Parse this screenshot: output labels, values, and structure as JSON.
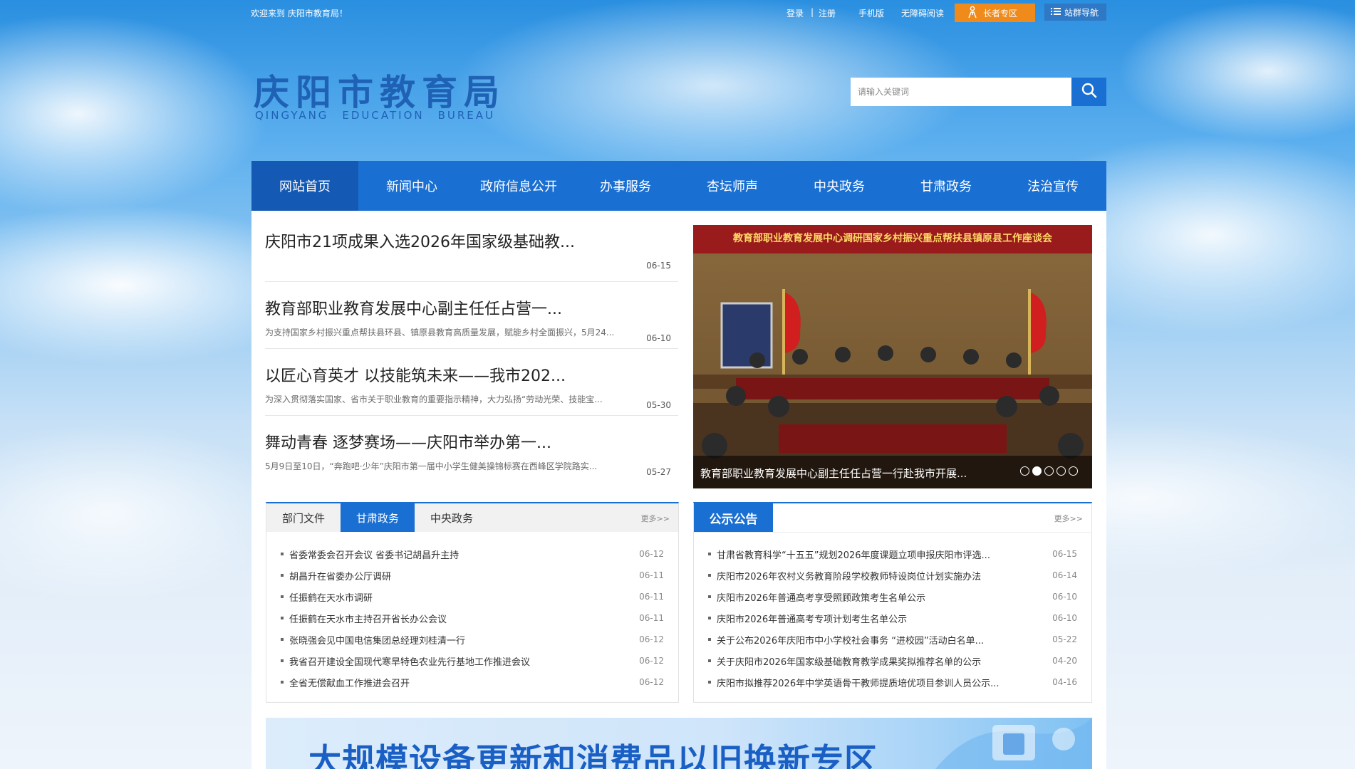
{
  "topbar": {
    "welcome": "欢迎来到 庆阳市教育局！",
    "login": "登录",
    "separator": "|",
    "register": "注册",
    "mobile": "手机版",
    "accessible": "无障碍阅读",
    "elderly": "长者专区",
    "sitenav": "站群导航"
  },
  "header": {
    "logo_cn": "庆阳市教育局",
    "logo_en": [
      "QINGYANG",
      "EDUCATION",
      "BUREAU"
    ],
    "search_placeholder": "请输入关键词"
  },
  "nav": [
    "网站首页",
    "新闻中心",
    "政府信息公开",
    "办事服务",
    "杏坛师声",
    "中央政务",
    "甘肃政务",
    "法治宣传"
  ],
  "news": [
    {
      "title": "庆阳市21项成果入选2026年国家级基础教...",
      "summary": "",
      "date": "06-15"
    },
    {
      "title": "教育部职业教育发展中心副主任任占营一...",
      "summary": "为支持国家乡村振兴重点帮扶县环县、镇原县教育高质量发展，赋能乡村全面振兴，5月24...",
      "date": "06-10"
    },
    {
      "title": "以匠心育英才 以技能筑未来——我市202...",
      "summary": "为深入贯彻落实国家、省市关于职业教育的重要指示精神，大力弘扬“劳动光荣、技能宝...",
      "date": "05-30"
    },
    {
      "title": "舞动青春 逐梦赛场——庆阳市举办第一...",
      "summary": "5月9日至10日，“奔跑吧·少年”庆阳市第一届中小学生健美操锦标赛在西峰区学院路实...",
      "date": "05-27"
    }
  ],
  "slider": {
    "banner_text": "教育部职业教育发展中心调研国家乡村振兴重点帮扶县镇原县工作座谈会",
    "caption": "教育部职业教育发展中心副主任任占营一行赴我市开展...",
    "active_dot": 2,
    "dot_count": 5
  },
  "left_box": {
    "tabs": [
      "部门文件",
      "甘肃政务",
      "中央政务"
    ],
    "active_tab": 1,
    "more": "更多>>",
    "items": [
      {
        "text": "省委常委会召开会议 省委书记胡昌升主持",
        "date": "06-12"
      },
      {
        "text": "胡昌升在省委办公厅调研",
        "date": "06-11"
      },
      {
        "text": "任振鹤在天水市调研",
        "date": "06-11"
      },
      {
        "text": "任振鹤在天水市主持召开省长办公会议",
        "date": "06-11"
      },
      {
        "text": "张晓强会见中国电信集团总经理刘桂清一行",
        "date": "06-12"
      },
      {
        "text": "我省召开建设全国现代寒旱特色农业先行基地工作推进会议",
        "date": "06-12"
      },
      {
        "text": "全省无偿献血工作推进会召开",
        "date": "06-12"
      }
    ]
  },
  "right_box": {
    "title": "公示公告",
    "more": "更多>>",
    "items": [
      {
        "text": "甘肃省教育科学“十五五”规划2026年度课题立项申报庆阳市评选...",
        "date": "06-15"
      },
      {
        "text": "庆阳市2026年农村义务教育阶段学校教师特设岗位计划实施办法",
        "date": "06-14"
      },
      {
        "text": "庆阳市2026年普通高考享受照顾政策考生名单公示",
        "date": "06-10"
      },
      {
        "text": "庆阳市2026年普通高考专项计划考生名单公示",
        "date": "06-10"
      },
      {
        "text": "关于公布2026年庆阳市中小学校社会事务 “进校园”活动白名单...",
        "date": "05-22"
      },
      {
        "text": "关于庆阳市2026年国家级基础教育教学成果奖拟推荐名单的公示",
        "date": "04-20"
      },
      {
        "text": "庆阳市拟推荐2026年中学英语骨干教师提质培优项目参训人员公示...",
        "date": "04-16"
      }
    ]
  },
  "bottom_banner": {
    "text": "大规模设备更新和消费品以旧换新专区"
  },
  "colors": {
    "primary": "#1a6fd2",
    "nav_active": "#1459b3",
    "elderly": "#f08a1a"
  }
}
